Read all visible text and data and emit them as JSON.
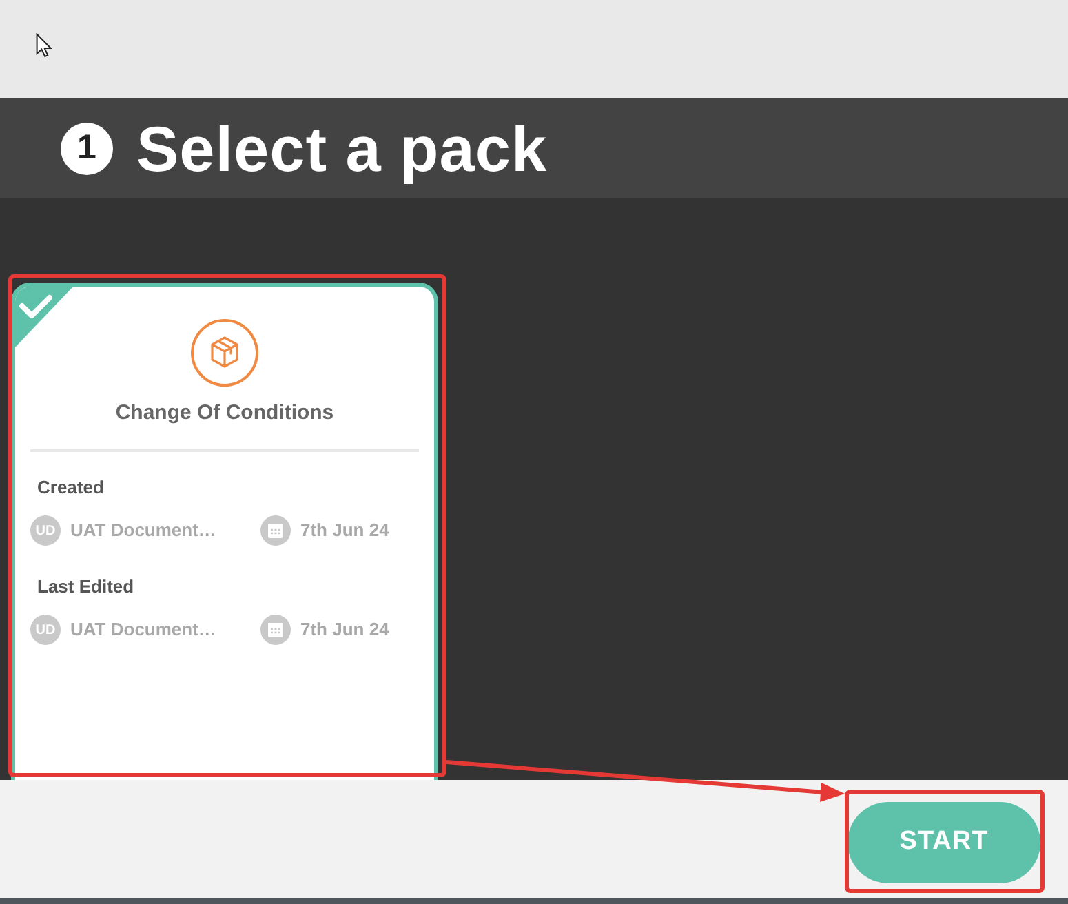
{
  "header": {
    "step": "1",
    "title": "Select a pack"
  },
  "packs": [
    {
      "title": "Change Of Conditions",
      "selected": true,
      "sections": [
        {
          "label": "Created",
          "user_initials": "UD",
          "user_name": "UAT Document…",
          "date": "7th Jun 24"
        },
        {
          "label": "Last Edited",
          "user_initials": "UD",
          "user_name": "UAT Document…",
          "date": "7th Jun 24"
        }
      ]
    }
  ],
  "footer": {
    "start_button": "START"
  },
  "annotations": [
    {
      "kind": "pack_highlight"
    },
    {
      "kind": "start_highlight"
    },
    {
      "kind": "arrow"
    }
  ]
}
